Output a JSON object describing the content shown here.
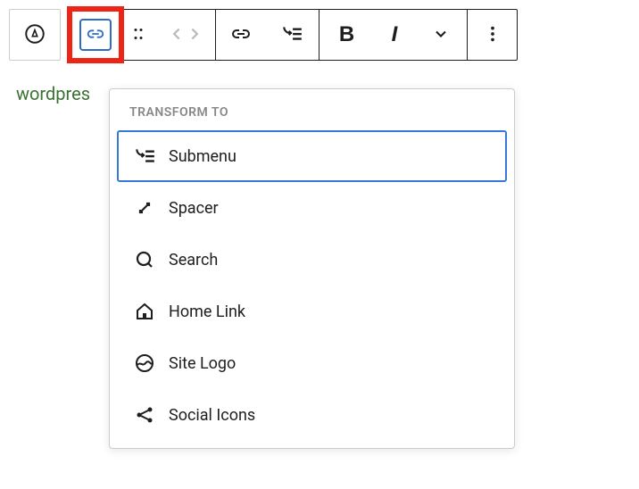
{
  "link_text": "wordpres",
  "popover": {
    "header": "Transform to",
    "options": [
      {
        "label": "Submenu"
      },
      {
        "label": "Spacer"
      },
      {
        "label": "Search"
      },
      {
        "label": "Home Link"
      },
      {
        "label": "Site Logo"
      },
      {
        "label": "Social Icons"
      }
    ]
  }
}
